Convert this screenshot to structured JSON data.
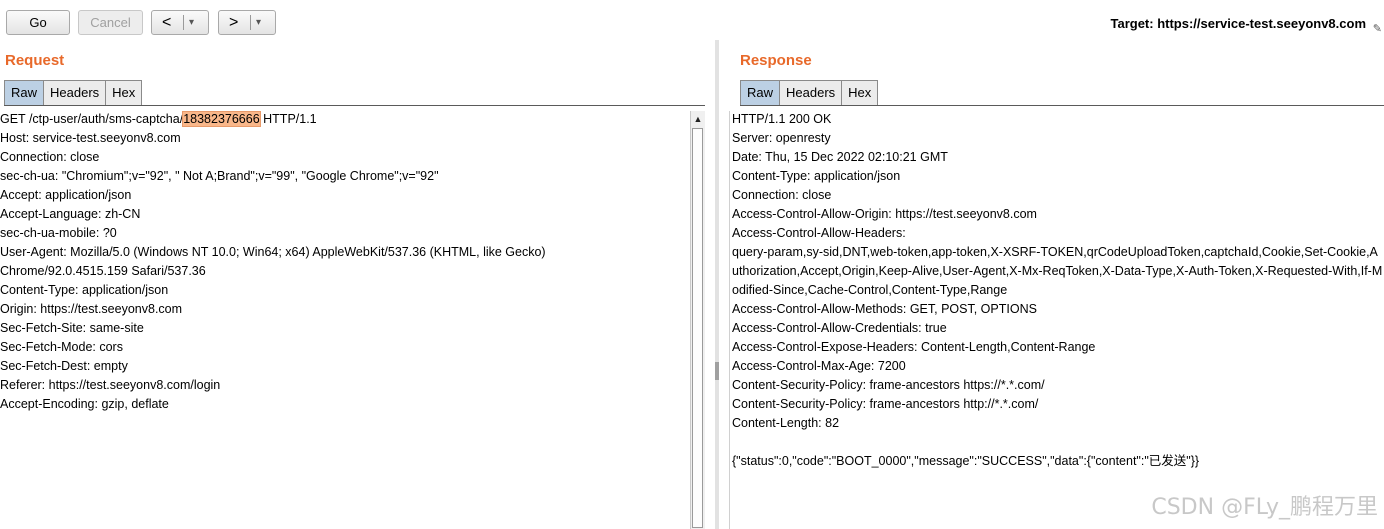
{
  "toolbar": {
    "go_label": "Go",
    "cancel_label": "Cancel",
    "back_arrow": "<",
    "forward_arrow": ">",
    "dropdown_glyph": "▾",
    "target": "Target: https://service-test.seeyonv8.com"
  },
  "request": {
    "title": "Request",
    "tabs": [
      "Raw",
      "Headers",
      "Hex"
    ],
    "active_tab": "Raw",
    "first_line_prefix": "GET /ctp-user/auth/sms-captcha/",
    "first_line_highlight": "18382376666",
    "first_line_suffix": " HTTP/1.1",
    "lines": [
      "Host: service-test.seeyonv8.com",
      "Connection: close",
      "sec-ch-ua: \"Chromium\";v=\"92\", \" Not A;Brand\";v=\"99\", \"Google Chrome\";v=\"92\"",
      "Accept: application/json",
      "Accept-Language: zh-CN",
      "sec-ch-ua-mobile: ?0",
      "User-Agent: Mozilla/5.0 (Windows NT 10.0; Win64; x64) AppleWebKit/537.36 (KHTML, like Gecko)",
      "Chrome/92.0.4515.159 Safari/537.36",
      "Content-Type: application/json",
      "Origin: https://test.seeyonv8.com",
      "Sec-Fetch-Site: same-site",
      "Sec-Fetch-Mode: cors",
      "Sec-Fetch-Dest: empty",
      "Referer: https://test.seeyonv8.com/login",
      "Accept-Encoding: gzip, deflate"
    ]
  },
  "response": {
    "title": "Response",
    "tabs": [
      "Raw",
      "Headers",
      "Hex"
    ],
    "active_tab": "Raw",
    "lines": [
      "HTTP/1.1 200 OK",
      "Server: openresty",
      "Date: Thu, 15 Dec 2022 02:10:21 GMT",
      "Content-Type: application/json",
      "Connection: close",
      "Access-Control-Allow-Origin: https://test.seeyonv8.com",
      "Access-Control-Allow-Headers:",
      "query-param,sy-sid,DNT,web-token,app-token,X-XSRF-TOKEN,qrCodeUploadToken,captchaId,Cookie,Set-Cookie,A",
      "uthorization,Accept,Origin,Keep-Alive,User-Agent,X-Mx-ReqToken,X-Data-Type,X-Auth-Token,X-Requested-With,If-M",
      "odified-Since,Cache-Control,Content-Type,Range",
      "Access-Control-Allow-Methods: GET, POST, OPTIONS",
      "Access-Control-Allow-Credentials: true",
      "Access-Control-Expose-Headers: Content-Length,Content-Range",
      "Access-Control-Max-Age: 7200",
      "Content-Security-Policy: frame-ancestors https://*.*.com/",
      "Content-Security-Policy: frame-ancestors http://*.*.com/",
      "Content-Length: 82",
      "",
      "{\"status\":0,\"code\":\"BOOT_0000\",\"message\":\"SUCCESS\",\"data\":{\"content\":\"已发送\"}}"
    ]
  },
  "watermark": "CSDN @FLy_鹏程万里",
  "colors": {
    "title_orange": "#e8692a",
    "active_tab": "#bcd0e4",
    "highlight": "#f9b78a"
  }
}
